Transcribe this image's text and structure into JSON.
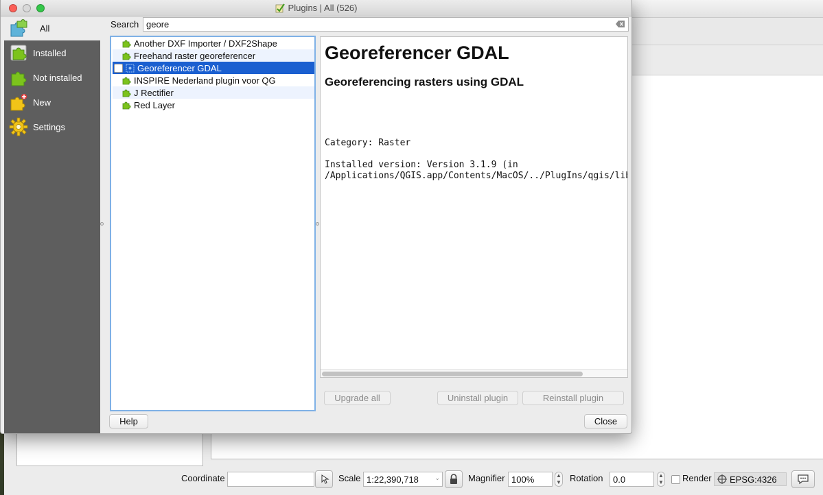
{
  "dialog": {
    "title": "Plugins | All (526)"
  },
  "sidebar": {
    "items": [
      {
        "label": "All",
        "icon": "puzzle-all-icon"
      },
      {
        "label": "Installed",
        "icon": "puzzle-installed-icon"
      },
      {
        "label": "Not installed",
        "icon": "puzzle-not-installed-icon"
      },
      {
        "label": "New",
        "icon": "puzzle-new-icon"
      },
      {
        "label": "Settings",
        "icon": "gear-icon"
      }
    ],
    "active": "All"
  },
  "search": {
    "label": "Search",
    "value": "geore"
  },
  "plugins": [
    {
      "name": "Another DXF Importer / DXF2Shape",
      "selected": false
    },
    {
      "name": "Freehand raster georeferencer",
      "selected": false
    },
    {
      "name": "Georeferencer GDAL",
      "selected": true
    },
    {
      "name": "INSPIRE Nederland plugin voor QG",
      "selected": false
    },
    {
      "name": "J Rectifier",
      "selected": false
    },
    {
      "name": "Red Layer",
      "selected": false
    }
  ],
  "details": {
    "title": "Georeferencer GDAL",
    "subtitle": "Georeferencing rasters using GDAL",
    "category": "Category: Raster",
    "installed_line1": "Installed version: Version 3.1.9 (in",
    "installed_line2": "/Applications/QGIS.app/Contents/MacOS/../PlugIns/qgis/libgeoref"
  },
  "buttons": {
    "upgrade_all": "Upgrade all",
    "uninstall": "Uninstall plugin",
    "reinstall": "Reinstall plugin",
    "help": "Help",
    "close": "Close"
  },
  "statusbar": {
    "coordinate_label": "Coordinate",
    "coordinate_value": "",
    "scale_label": "Scale",
    "scale_value": "1:22,390,718",
    "magnifier_label": "Magnifier",
    "magnifier_value": "100%",
    "rotation_label": "Rotation",
    "rotation_value": "0.0",
    "render_label": "Render",
    "epsg": "EPSG:4326"
  },
  "colors": {
    "sidebar_bg": "#5e5e5e",
    "selection": "#1a5fd0",
    "list_border": "#7fb1e6",
    "puzzle_green": "#7cc31c"
  }
}
